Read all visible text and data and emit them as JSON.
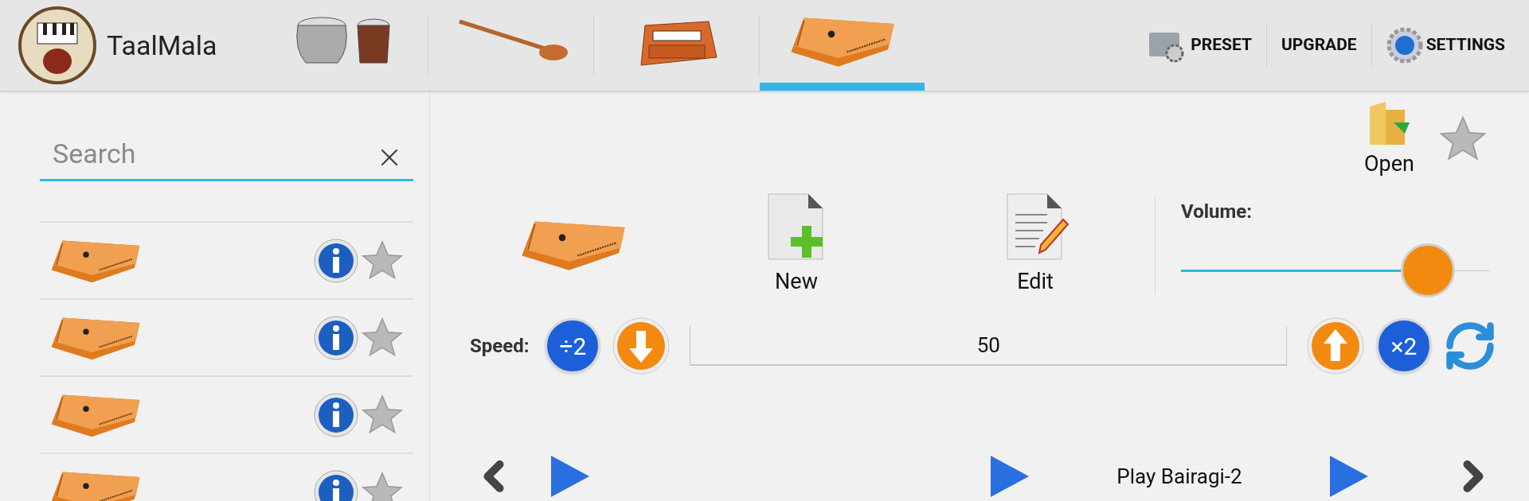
{
  "app": {
    "title": "TaalMala"
  },
  "instrument_tabs": [
    {
      "kind": "tabla",
      "selected": false
    },
    {
      "kind": "sitar",
      "selected": false
    },
    {
      "kind": "harmonium",
      "selected": false
    },
    {
      "kind": "swarmandal",
      "selected": true
    }
  ],
  "toolbar": [
    {
      "kind": "preset",
      "label": "PRESET"
    },
    {
      "kind": "upgrade",
      "label": "UPGRADE"
    },
    {
      "kind": "settings",
      "label": "SETTINGS"
    }
  ],
  "search": {
    "placeholder": "Search"
  },
  "list_rows": [
    {
      "favorite": false
    },
    {
      "favorite": false
    },
    {
      "favorite": false
    },
    {
      "favorite": false
    }
  ],
  "header": {
    "open_label": "Open",
    "favorite": false
  },
  "actions": [
    {
      "kind": "new",
      "label": "New"
    },
    {
      "kind": "edit",
      "label": "Edit"
    }
  ],
  "volume": {
    "label": "Volume:",
    "level": 0.8
  },
  "speed": {
    "label": "Speed:",
    "halve_label": "÷2",
    "double_label": "×2",
    "value": "50"
  },
  "player": {
    "label": "Play Bairagi-2"
  }
}
